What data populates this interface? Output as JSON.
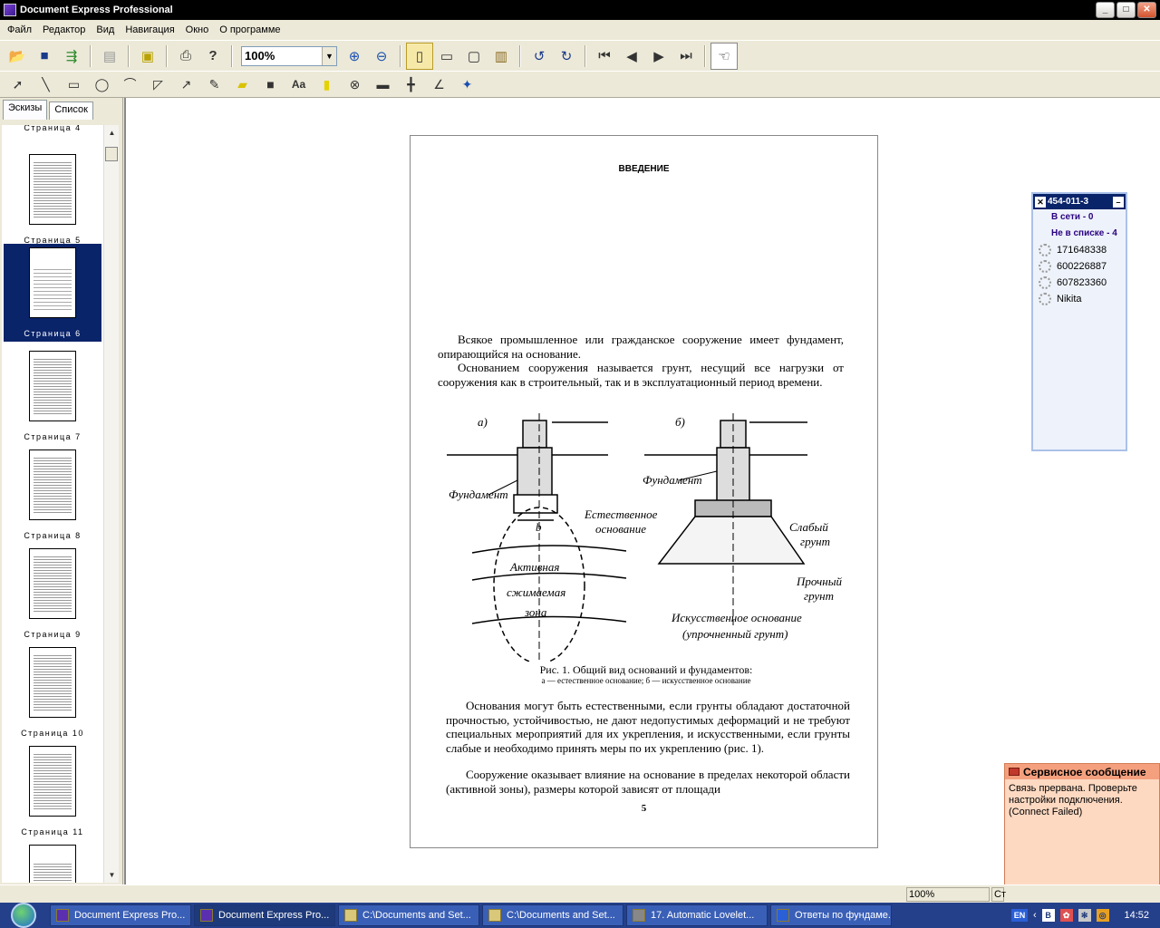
{
  "window": {
    "title": "Document Express Professional"
  },
  "menu": [
    "Файл",
    "Редактор",
    "Вид",
    "Навигация",
    "Окно",
    "О программе"
  ],
  "toolbar": {
    "zoom_value": "100%"
  },
  "left_panel": {
    "tabs": [
      "Эскизы",
      "Список"
    ],
    "top_partial_label": "Страница 4",
    "thumbnails": [
      {
        "label": "Страница 5",
        "selected": false
      },
      {
        "label": "Страница 6",
        "selected": true
      },
      {
        "label": "Страница 7",
        "selected": false
      },
      {
        "label": "Страница 8",
        "selected": false
      },
      {
        "label": "Страница 9",
        "selected": false
      },
      {
        "label": "Страница 10",
        "selected": false
      },
      {
        "label": "Страница 11",
        "selected": false
      }
    ]
  },
  "document": {
    "heading": "ВВЕДЕНИЕ",
    "para1": "Всякое промышленное или гражданское сооружение имеет фундамент, опирающийся на основание.",
    "para2": "Основанием сооружения называется грунт, несущий все нагрузки от сооружения как в строительный, так и в эксплуатационный период времени.",
    "figure_labels": {
      "a": "а)",
      "b": "б)",
      "foundation_left": "Фундамент",
      "width_b": "b",
      "natural_base_1": "Естественное",
      "natural_base_2": "основание",
      "zone_1": "Активная",
      "zone_2": "сжимаемая",
      "zone_3": "зона",
      "foundation_right": "Фундамент",
      "weak_soil_1": "Слабый",
      "weak_soil_2": "грунт",
      "strong_soil_1": "Прочный",
      "strong_soil_2": "грунт",
      "artificial_1": "Искусственное основание",
      "artificial_2": "(упрочненный грунт)"
    },
    "caption_line1": "Рис. 1. Общий вид оснований и фундаментов:",
    "caption_line2": "а — естественное основание; б — искусственное основание",
    "para3": "Основания могут быть естественными, если грунты обладают достаточной прочностью, устойчивостью, не дают недопустимых деформаций и не требуют специальных мероприятий для их укрепления, и искусственными, если грунты слабые и необходимо принять меры по их укреплению (рис. 1).",
    "para4": "Сооружение оказывает влияние на основание в пределах некоторой области (активной зоны), размеры которой зависят от площади",
    "page_number": "5"
  },
  "contacts": {
    "account": "454-011-3",
    "group_online": "В сети - 0",
    "group_offline": "Не в списке - 4",
    "items": [
      "171648338",
      "600226887",
      "607823360",
      "Nikita"
    ]
  },
  "service_message": {
    "title": "Сервисное сообщение",
    "text": "Связь прервана. Проверьте настройки подключения. (Connect Failed)"
  },
  "statusbar": {
    "zoom": "100%",
    "cell2": "Ст"
  },
  "taskbar": {
    "tasks": [
      "Document Express Pro...",
      "Document Express Pro...",
      "C:\\Documents and Set...",
      "C:\\Documents and Set...",
      "17. Automatic Lovelet...",
      "Ответы по фундаме..."
    ],
    "lang": "EN",
    "clock": "14:52"
  }
}
